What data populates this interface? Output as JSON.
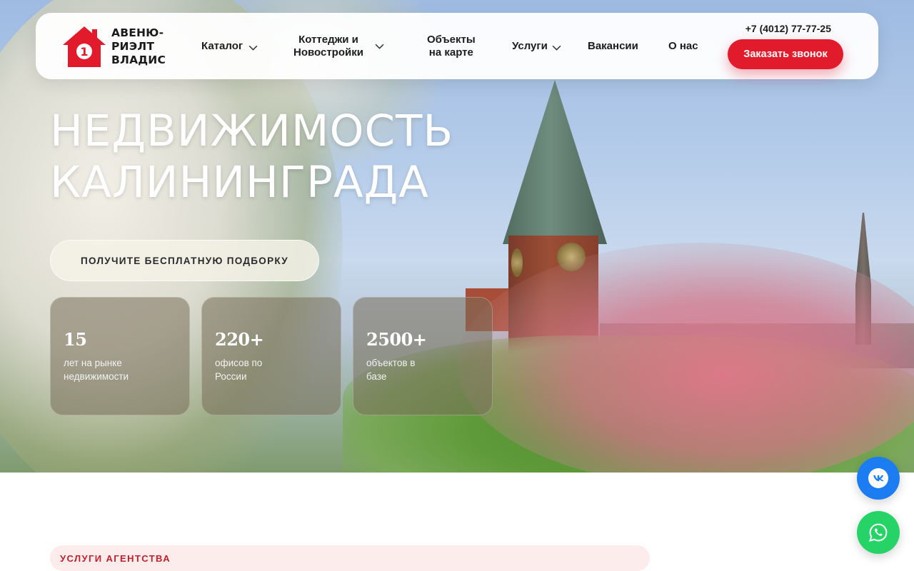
{
  "header": {
    "logo_line1": "АВЕНЮ-",
    "logo_line2": "РИЭЛТ",
    "logo_line3": "ВЛАДИС",
    "logo_badge": "1",
    "nav": [
      {
        "label": "Каталог",
        "has_dropdown": true
      },
      {
        "label_line1": "Коттеджи и",
        "label_line2": "Новостройки",
        "has_dropdown": true
      },
      {
        "label_line1": "Объекты",
        "label_line2": "на карте",
        "has_dropdown": false
      },
      {
        "label": "Услуги",
        "has_dropdown": true
      },
      {
        "label": "Вакансии",
        "has_dropdown": false
      },
      {
        "label": "О нас",
        "has_dropdown": false
      }
    ],
    "phone": "+7 (4012) 77-77-25",
    "call_button": "Заказать звонок"
  },
  "hero": {
    "title_line1": "НЕДВИЖИМОСТЬ",
    "title_line2": "КАЛИНИНГРАДА",
    "cta_button": "ПОЛУЧИТЕ БЕСПЛАТНУЮ ПОДБОРКУ",
    "stats": [
      {
        "value": "15",
        "caption_line1": "лет на рынке",
        "caption_line2": "недвижимости"
      },
      {
        "value": "220+",
        "caption_line1": "офисов по",
        "caption_line2": "России"
      },
      {
        "value": "2500+",
        "caption_line1": "объектов в",
        "caption_line2": "базе"
      }
    ]
  },
  "services": {
    "section_label": "УСЛУГИ АГЕНТСТВА"
  },
  "floating": {
    "vk_icon": "vk-icon",
    "whatsapp_icon": "whatsapp-icon"
  },
  "colors": {
    "brand_red": "#e11b2b",
    "vk_blue": "#1c7cf2",
    "whatsapp_green": "#25d366"
  }
}
